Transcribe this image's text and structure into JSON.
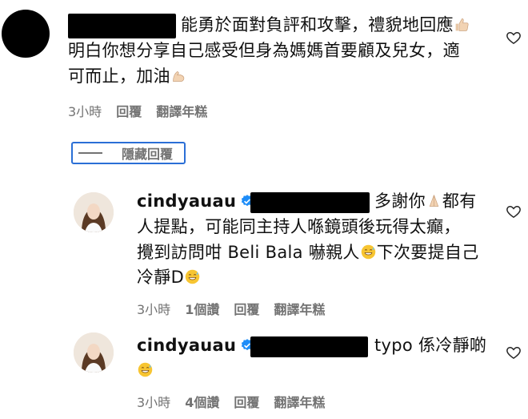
{
  "comments": [
    {
      "lines": [
        "能勇於面對負評和攻擊，禮貌地回應",
        "明白你想分享自己感受但身為媽媽首要顧及兒女，適",
        "可而止，加油"
      ],
      "meta": {
        "time": "3小時",
        "reply": "回覆",
        "translate": "翻譯年糕"
      }
    }
  ],
  "hide_replies_label": "隱藏回覆",
  "replies": [
    {
      "username": "cindyauau",
      "lines": [
        "多謝你",
        "都有",
        "人提點，可能同主持人喺鏡頭後玩得太癲，",
        "攪到訪問咁 Beli Bala 嚇親人",
        "下次要提自己",
        "冷靜D"
      ],
      "meta": {
        "time": "3小時",
        "likes": "1個讚",
        "reply": "回覆",
        "translate": "翻譯年糕"
      }
    },
    {
      "username": "cindyauau",
      "lines": [
        "typo 係冷靜啲"
      ],
      "meta": {
        "time": "3小時",
        "likes": "4個讚",
        "reply": "回覆",
        "translate": "翻譯年糕"
      }
    }
  ],
  "icons": {
    "like": "heart-icon",
    "verified": "verified-badge-icon",
    "thumbs_up": "thumbs-up-emoji",
    "flex": "flexed-biceps-emoji",
    "pray": "folded-hands-emoji",
    "grin_sweat": "grinning-sweat-emoji"
  },
  "colors": {
    "meta_gray": "#737373",
    "highlight_blue": "#2b6fd6",
    "verified_blue": "#1d8cf8"
  }
}
